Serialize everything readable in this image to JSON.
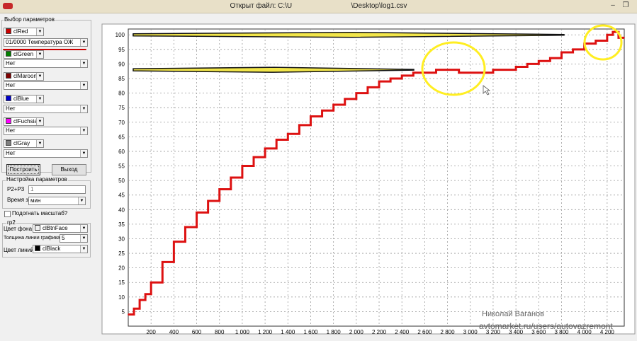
{
  "window": {
    "title": "Открыт файл: C:\\U                              \\Desktop\\log1.csv",
    "minimize_glyph": "–",
    "restore_glyph": "❐"
  },
  "params": {
    "group_label": "Выбор параметров",
    "rows": [
      {
        "color_name": "clRed",
        "swatch": "#cc0000",
        "param": "01/0000 Температура ОЖ"
      },
      {
        "color_name": "clGreen",
        "swatch": "#008000",
        "param": "Нет"
      },
      {
        "color_name": "clMaroon",
        "swatch": "#800000",
        "param": "Нет"
      },
      {
        "color_name": "clBlue",
        "swatch": "#0000cc",
        "param": "Нет"
      },
      {
        "color_name": "clFuchsia",
        "swatch": "#ff00ff",
        "param": "Нет"
      },
      {
        "color_name": "clGray",
        "swatch": "#808080",
        "param": "Нет"
      }
    ]
  },
  "buttons": {
    "build": "Построить",
    "exit": "Выход"
  },
  "settings": {
    "group_label": "Настройка параметров",
    "p2p3_label": "P2+P3",
    "p2p3_value": "1",
    "time_label": "Время з",
    "time_value": "мин"
  },
  "scale_checkbox_label": "Подогнать масштаб?",
  "gr2": {
    "group_label": "гр2",
    "bg_label": "Цвет фона",
    "bg_value": "clBtnFace",
    "bg_swatch": "#f0f0f0",
    "width_label": "Толщина линии графика",
    "width_value": "5",
    "line_color_label": "Цвет линий",
    "line_color_value": "clBlack",
    "line_swatch": "#000000"
  },
  "watermark": {
    "name": "Николай Ваганов",
    "site": "avtomarket.ru/users/autovazremont"
  },
  "chart_data": {
    "type": "line",
    "title": "",
    "xlabel": "",
    "ylabel": "",
    "xlim": [
      0,
      4350
    ],
    "ylim": [
      0,
      102
    ],
    "grid": true,
    "x_ticks": [
      "200",
      "400",
      "600",
      "800",
      "1 000",
      "1 200",
      "1 400",
      "1 600",
      "1 800",
      "2 000",
      "2 200",
      "2 400",
      "2 600",
      "2 800",
      "3 000",
      "3 200",
      "3 400",
      "3 600",
      "3 800",
      "4 000",
      "4 200"
    ],
    "y_ticks": [
      "5",
      "10",
      "15",
      "20",
      "25",
      "30",
      "35",
      "40",
      "45",
      "50",
      "55",
      "60",
      "65",
      "70",
      "75",
      "80",
      "85",
      "90",
      "95",
      "100"
    ],
    "series": [
      {
        "color": "#dd1111",
        "x": [
          0,
          50,
          100,
          150,
          200,
          300,
          400,
          500,
          600,
          700,
          800,
          900,
          1000,
          1100,
          1200,
          1300,
          1400,
          1500,
          1600,
          1700,
          1800,
          1900,
          2000,
          2100,
          2200,
          2300,
          2400,
          2500,
          2600,
          2700,
          2800,
          2900,
          3000,
          3100,
          3200,
          3300,
          3400,
          3500,
          3600,
          3700,
          3800,
          3900,
          4000,
          4100,
          4200,
          4250,
          4300,
          4350
        ],
        "y": [
          4,
          6,
          9,
          11,
          15,
          22,
          29,
          34,
          39,
          43,
          47,
          51,
          55,
          58,
          61,
          64,
          66,
          69,
          72,
          74,
          76,
          78,
          80,
          82,
          84,
          85,
          86,
          87,
          87,
          88,
          88,
          87,
          87,
          87,
          88,
          88,
          89,
          90,
          91,
          92,
          94,
          95,
          97,
          98,
          100,
          101,
          99,
          99
        ]
      }
    ]
  },
  "overlay": {
    "highlight_color": "#ffee22",
    "arrow_color": "#f2e64a",
    "underline_color": "#cc0000"
  }
}
